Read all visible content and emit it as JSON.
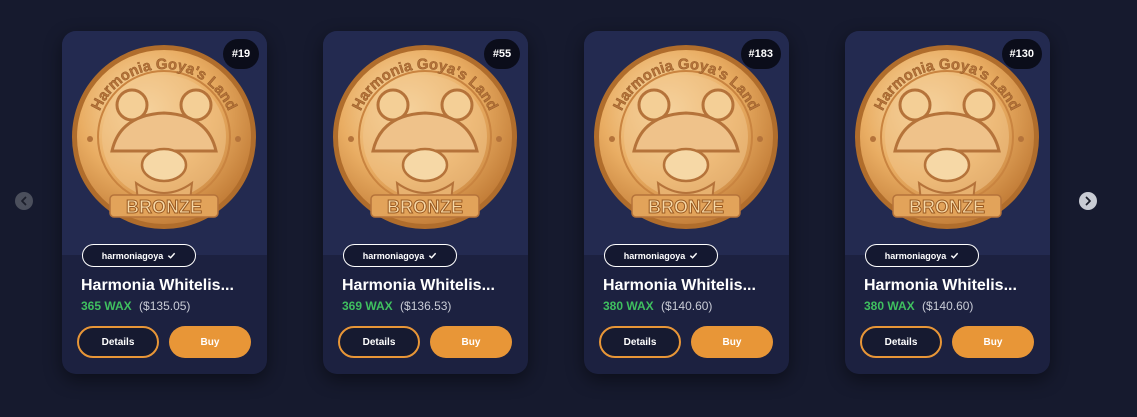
{
  "carousel": {
    "prev_label": "",
    "next_label": "",
    "cards": [
      {
        "badge": "#19",
        "collection": "harmoniagoya",
        "title": "Harmonia Whitelis...",
        "price_wax": "365 WAX",
        "price_usd": "($135.05)",
        "details_label": "Details",
        "buy_label": "Buy"
      },
      {
        "badge": "#55",
        "collection": "harmoniagoya",
        "title": "Harmonia Whitelis...",
        "price_wax": "369 WAX",
        "price_usd": "($136.53)",
        "details_label": "Details",
        "buy_label": "Buy"
      },
      {
        "badge": "#183",
        "collection": "harmoniagoya",
        "title": "Harmonia Whitelis...",
        "price_wax": "380 WAX",
        "price_usd": "($140.60)",
        "details_label": "Details",
        "buy_label": "Buy"
      },
      {
        "badge": "#130",
        "collection": "harmoniagoya",
        "title": "Harmonia Whitelis...",
        "price_wax": "380 WAX",
        "price_usd": "($140.60)",
        "details_label": "Details",
        "buy_label": "Buy"
      }
    ]
  },
  "coin": {
    "top_text": "Harmonia Goya's Land",
    "bottom_text": "BRONZE"
  },
  "colors": {
    "background": "#161a2e",
    "card": "#1c2140",
    "accent": "#e89637",
    "wax": "#3fbf5f"
  },
  "icons": {
    "prev": "chevron-left-icon",
    "next": "chevron-right-icon",
    "verified": "check-icon"
  }
}
